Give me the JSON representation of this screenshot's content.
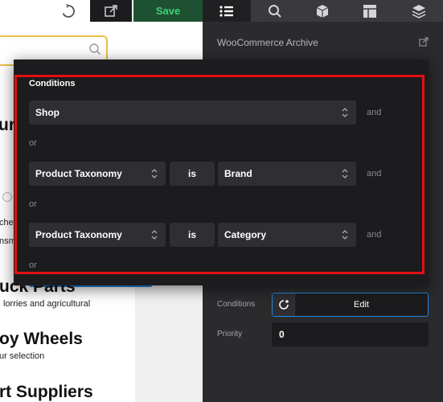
{
  "toolbar": {
    "save_label": "Save",
    "icons": [
      "loader-icon",
      "export-icon",
      "list-icon",
      "search-icon",
      "box-icon",
      "layout-icon",
      "layers-icon"
    ],
    "colors": {
      "save_bg": "#1e5131",
      "save_text": "#3bd07a",
      "active_tab": "#202022",
      "inactive_tab": "#3a3a3e"
    }
  },
  "preview": {
    "heading_1": "ur",
    "snippet_1": "che",
    "snippet_2": "nsm",
    "heading_2": "uck Parts",
    "text_2": "lorries and agricultural",
    "heading_3": "oy Wheels",
    "text_3": "ur selection",
    "heading_4": "rt Suppliers"
  },
  "panel": {
    "title": "WooCommerce Archive",
    "conditions_label": "Conditions",
    "edit_label": "Edit",
    "priority_label": "Priority",
    "priority_value": "0"
  },
  "conditions_popup": {
    "title": "Conditions",
    "highlight_color": "#e01010",
    "groups": [
      {
        "type": "Shop",
        "and_label": "and",
        "or_label": "or"
      },
      {
        "type": "Product Taxonomy",
        "operator": "is",
        "value": "Brand",
        "and_label": "and",
        "or_label": "or"
      },
      {
        "type": "Product Taxonomy",
        "operator": "is",
        "value": "Category",
        "and_label": "and",
        "or_label": "or"
      }
    ]
  }
}
